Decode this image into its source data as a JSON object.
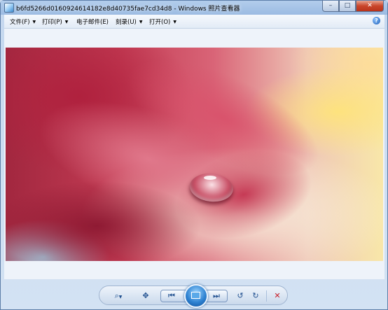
{
  "window": {
    "title": "b6fd5266d0160924614182e8d40735fae7cd34d8 - Windows 照片查看器"
  },
  "caption_buttons": {
    "minimize": "–",
    "maximize": "□",
    "close": "✕"
  },
  "menu": {
    "items": [
      {
        "label": "文件(F)"
      },
      {
        "label": "打印(P)"
      },
      {
        "label": "电子邮件(E)"
      },
      {
        "label": "刻录(U)"
      },
      {
        "label": "打开(O)"
      }
    ],
    "help": "?"
  },
  "toolbar": {
    "zoom": "⌕",
    "actual_size": "✥",
    "previous": "⏮",
    "next": "⏭",
    "rotate_ccw": "↺",
    "rotate_cw": "↻",
    "delete": "✕"
  },
  "colors": {
    "accent": "#1f4f8f",
    "delete": "#c8202a"
  }
}
